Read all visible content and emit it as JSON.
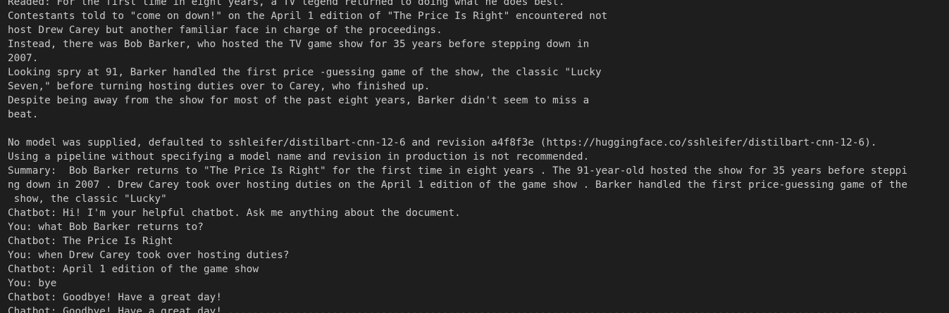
{
  "terminal": {
    "lines": [
      "Readed: For the first time in eight years, a TV legend returned to doing what he does best.",
      "Contestants told to \"come on down!\" on the April 1 edition of \"The Price Is Right\" encountered not",
      "host Drew Carey but another familiar face in charge of the proceedings.",
      "Instead, there was Bob Barker, who hosted the TV game show for 35 years before stepping down in",
      "2007.",
      "Looking spry at 91, Barker handled the first price -guessing game of the show, the classic \"Lucky",
      "Seven,\" before turning hosting duties over to Carey, who finished up.",
      "Despite being away from the show for most of the past eight years, Barker didn't seem to miss a",
      "beat.",
      "",
      "No model was supplied, defaulted to sshleifer/distilbart-cnn-12-6 and revision a4f8f3e (https://huggingface.co/sshleifer/distilbart-cnn-12-6).",
      "Using a pipeline without specifying a model name and revision in production is not recommended.",
      "Summary:  Bob Barker returns to \"The Price Is Right\" for the first time in eight years . The 91-year-old hosted the show for 35 years before steppi",
      "ng down in 2007 . Drew Carey took over hosting duties on the April 1 edition of the game show . Barker handled the first price-guessing game of the",
      " show, the classic \"Lucky\"",
      "Chatbot: Hi! I'm your helpful chatbot. Ask me anything about the document.",
      "You: what Bob Barker returns to?",
      "Chatbot: The Price Is Right",
      "You: when Drew Carey took over hosting duties?",
      "Chatbot: April 1 edition of the game show",
      "You: bye",
      "Chatbot: Goodbye! Have a great day!"
    ],
    "cutoff_line": "Chatbot: Goodbye! Have a great day! ............................................................................................................",
    "corner_glyph": "'"
  }
}
